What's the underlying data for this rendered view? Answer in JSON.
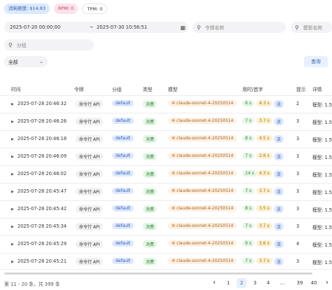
{
  "stats": {
    "quota": "消耗额度: $14.83",
    "rpm": "RPM: 0",
    "tpm": "TPM: 0"
  },
  "filters": {
    "start_time": "2025-07-20 00:00:00",
    "range_sep": "~",
    "end_time": "2025-07-30 10:56:51",
    "token_placeholder": "令牌名称",
    "model_placeholder": "模型名称",
    "group_placeholder": "分组",
    "type_select": "全部",
    "query_button": "查询"
  },
  "table": {
    "headers": [
      "时间",
      "令牌",
      "分组",
      "类型",
      "模型",
      "用时/首字",
      "提示",
      "详情"
    ],
    "rows": [
      {
        "time": "2025-07-28 20:46:32",
        "token": "命令行 API",
        "group": "default",
        "type": "消费",
        "model": "claude-sonnet-4-20250514",
        "use": "6 s",
        "first": "4.3 s",
        "stream": "流",
        "prompt": "2",
        "detail": "模型: 1.5"
      },
      {
        "time": "2025-07-28 20:46:26",
        "token": "命令行 API",
        "group": "default",
        "type": "消费",
        "model": "claude-sonnet-4-20250514",
        "use": "7 s",
        "first": "3.7 s",
        "stream": "流",
        "prompt": "3",
        "detail": "模型: 1.5"
      },
      {
        "time": "2025-07-28 20:46:18",
        "token": "命令行 API",
        "group": "default",
        "type": "消费",
        "model": "claude-sonnet-4-20250514",
        "use": "8 s",
        "first": "4.5 s",
        "stream": "流",
        "prompt": "3",
        "detail": "模型: 1.5"
      },
      {
        "time": "2025-07-28 20:46:09",
        "token": "命令行 API",
        "group": "default",
        "type": "消费",
        "model": "claude-sonnet-4-20250514",
        "use": "7 s",
        "first": "2.6 s",
        "stream": "流",
        "prompt": "3",
        "detail": "模型: 1.5"
      },
      {
        "time": "2025-07-28 20:46:02",
        "token": "命令行 API",
        "group": "default",
        "type": "消费",
        "model": "claude-sonnet-4-20250514",
        "use": "14 s",
        "first": "4.3 s",
        "stream": "流",
        "prompt": "3",
        "detail": "模型: 1.5"
      },
      {
        "time": "2025-07-28 20:45:47",
        "token": "命令行 API",
        "group": "default",
        "type": "消费",
        "model": "claude-sonnet-4-20250514",
        "use": "7 s",
        "first": "3.7 s",
        "stream": "流",
        "prompt": "3",
        "detail": "模型: 1.5"
      },
      {
        "time": "2025-07-28 20:45:42",
        "token": "命令行 API",
        "group": "default",
        "type": "消费",
        "model": "claude-sonnet-4-20250514",
        "use": "8 s",
        "first": "3.5 s",
        "stream": "流",
        "prompt": "3",
        "detail": "模型: 1.5"
      },
      {
        "time": "2025-07-28 20:45:34",
        "token": "命令行 API",
        "group": "default",
        "type": "消费",
        "model": "claude-sonnet-4-20250514",
        "use": "7 s",
        "first": "3.7 s",
        "stream": "流",
        "prompt": "3",
        "detail": "模型: 1.5"
      },
      {
        "time": "2025-07-28 20:45:29",
        "token": "命令行 API",
        "group": "default",
        "type": "消费",
        "model": "claude-sonnet-4-20250514",
        "use": "9 s",
        "first": "3.6 s",
        "stream": "流",
        "prompt": "4",
        "detail": "模型: 1.5"
      },
      {
        "time": "2025-07-28 20:45:21",
        "token": "命令行 API",
        "group": "default",
        "type": "消费",
        "model": "claude-sonnet-4-20250514",
        "use": "7 s",
        "first": "3.7 s",
        "stream": "流",
        "prompt": "3",
        "detail": "模型: 1.5"
      }
    ]
  },
  "footer": {
    "summary": "第 11 - 20 条，共 399 条",
    "prev": "‹",
    "pages": [
      "1",
      "2",
      "3",
      "4",
      "...",
      "39",
      "40"
    ],
    "next": "›"
  },
  "icons": {
    "calendar": "calendar-icon",
    "search": "search-icon",
    "chevron": "chevron-down-icon",
    "expand": "expand-arrow-icon",
    "star": "model-icon"
  }
}
